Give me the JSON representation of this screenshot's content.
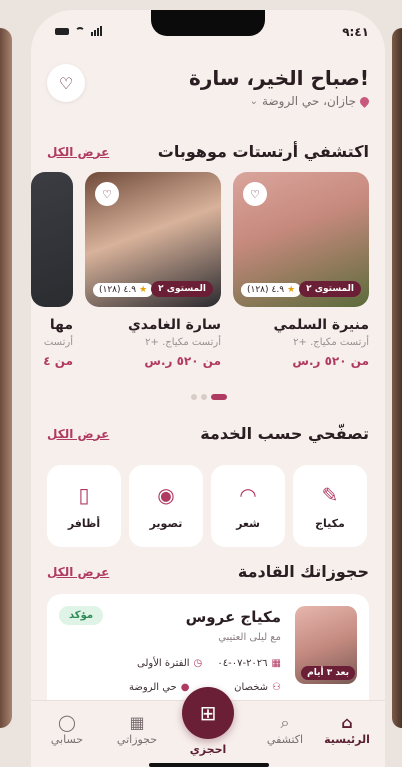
{
  "status_bar": {
    "time": "٩:٤١"
  },
  "header": {
    "greeting": "صباح الخير، سارة!",
    "location": "جازان، حي الروضة"
  },
  "artists_section": {
    "title": "اكتشفي أرتستات موهوبات",
    "see_all": "عرض الكل",
    "cards": [
      {
        "name": "منيرة السلمي",
        "subtitle": "أرتست مكياج. +٢",
        "price": "من ٥٢٠ ر.س",
        "level": "المستوى ٢",
        "rating": "٤.٩",
        "reviews": "(١٢٨)"
      },
      {
        "name": "سارة الغامدي",
        "subtitle": "أرتست مكياج. +٢",
        "price": "من ٥٢٠ ر.س",
        "level": "المستوى ٢",
        "rating": "٤.٩",
        "reviews": "(١٢٨)"
      },
      {
        "name": "مها",
        "subtitle": "أرتست",
        "price": "من ٤"
      }
    ]
  },
  "services_section": {
    "title": "تصفّحي حسب الخدمة",
    "see_all": "عرض الكل",
    "items": [
      {
        "label": "مكياج",
        "icon": "makeup-brush-icon"
      },
      {
        "label": "شعر",
        "icon": "hair-icon"
      },
      {
        "label": "تصوير",
        "icon": "camera-icon"
      },
      {
        "label": "أظافر",
        "icon": "nail-polish-icon"
      }
    ]
  },
  "bookings_section": {
    "title": "حجوزاتك القادمة",
    "see_all": "عرض الكل",
    "booking": {
      "title": "مكياج عروس",
      "subtitle": "مع ليلى العتيبي",
      "status": "مؤكد",
      "days_left": "بعد ٣ أيام",
      "date": "٢٠٢٦-٠٧-٠٤",
      "period": "الفترة الأولى",
      "guests": "شخصان",
      "area": "حي الروضة"
    }
  },
  "tab_bar": {
    "tabs": [
      {
        "label": "الرئيسية",
        "icon": "home-icon",
        "active": true
      },
      {
        "label": "اكتشفي",
        "icon": "search-icon"
      },
      {
        "label": "احجزي",
        "icon": "calendar-plus-icon"
      },
      {
        "label": "حجوزاتي",
        "icon": "calendar-icon"
      },
      {
        "label": "حسابي",
        "icon": "user-icon"
      }
    ]
  },
  "colors": {
    "accent": "#6a1f36",
    "link": "#b03b62",
    "background": "#f7efec",
    "confirmed": "#2e8b57"
  }
}
